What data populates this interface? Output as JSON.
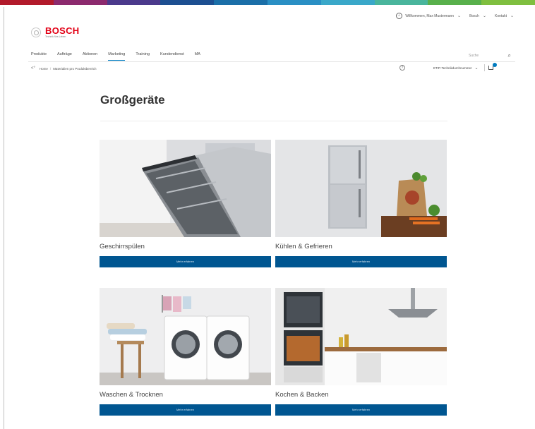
{
  "colors": {
    "supergraphic": [
      "#b21a2b",
      "#8c2a6e",
      "#4b3a8c",
      "#1d4f91",
      "#1b6fa8",
      "#2a8fc4",
      "#3aa8c9",
      "#49b59c",
      "#58b04b",
      "#7fbf3f"
    ],
    "brand": "#e20015",
    "button": "#005691",
    "accent": "#007bc0"
  },
  "header": {
    "utility": {
      "welcome": "Willkommen, Max Mustermann",
      "account": "Bosch",
      "contact": "Kontakt"
    },
    "logo": {
      "brand": "BOSCH",
      "sub": "Technik fürs Leben"
    },
    "nav": [
      "Produkte",
      "Aufträge",
      "Aktionen",
      "Marketing",
      "Training",
      "Kundendienst",
      "MA"
    ],
    "search_placeholder": "Suche"
  },
  "breadcrumb": {
    "home": "Home",
    "current": "Materialien pro Produktbereich"
  },
  "tools": {
    "number_select": "ETIP-Technikdurchnummer"
  },
  "page": {
    "title": "Großgeräte"
  },
  "categories": [
    {
      "label": "Geschirrspülen",
      "button": "Mehr erfahren"
    },
    {
      "label": "Kühlen & Gefrieren",
      "button": "Mehr erfahren"
    },
    {
      "label": "Waschen & Trocknen",
      "button": "Mehr erfahren"
    },
    {
      "label": "Kochen & Backen",
      "button": "Mehr erfahren"
    }
  ]
}
